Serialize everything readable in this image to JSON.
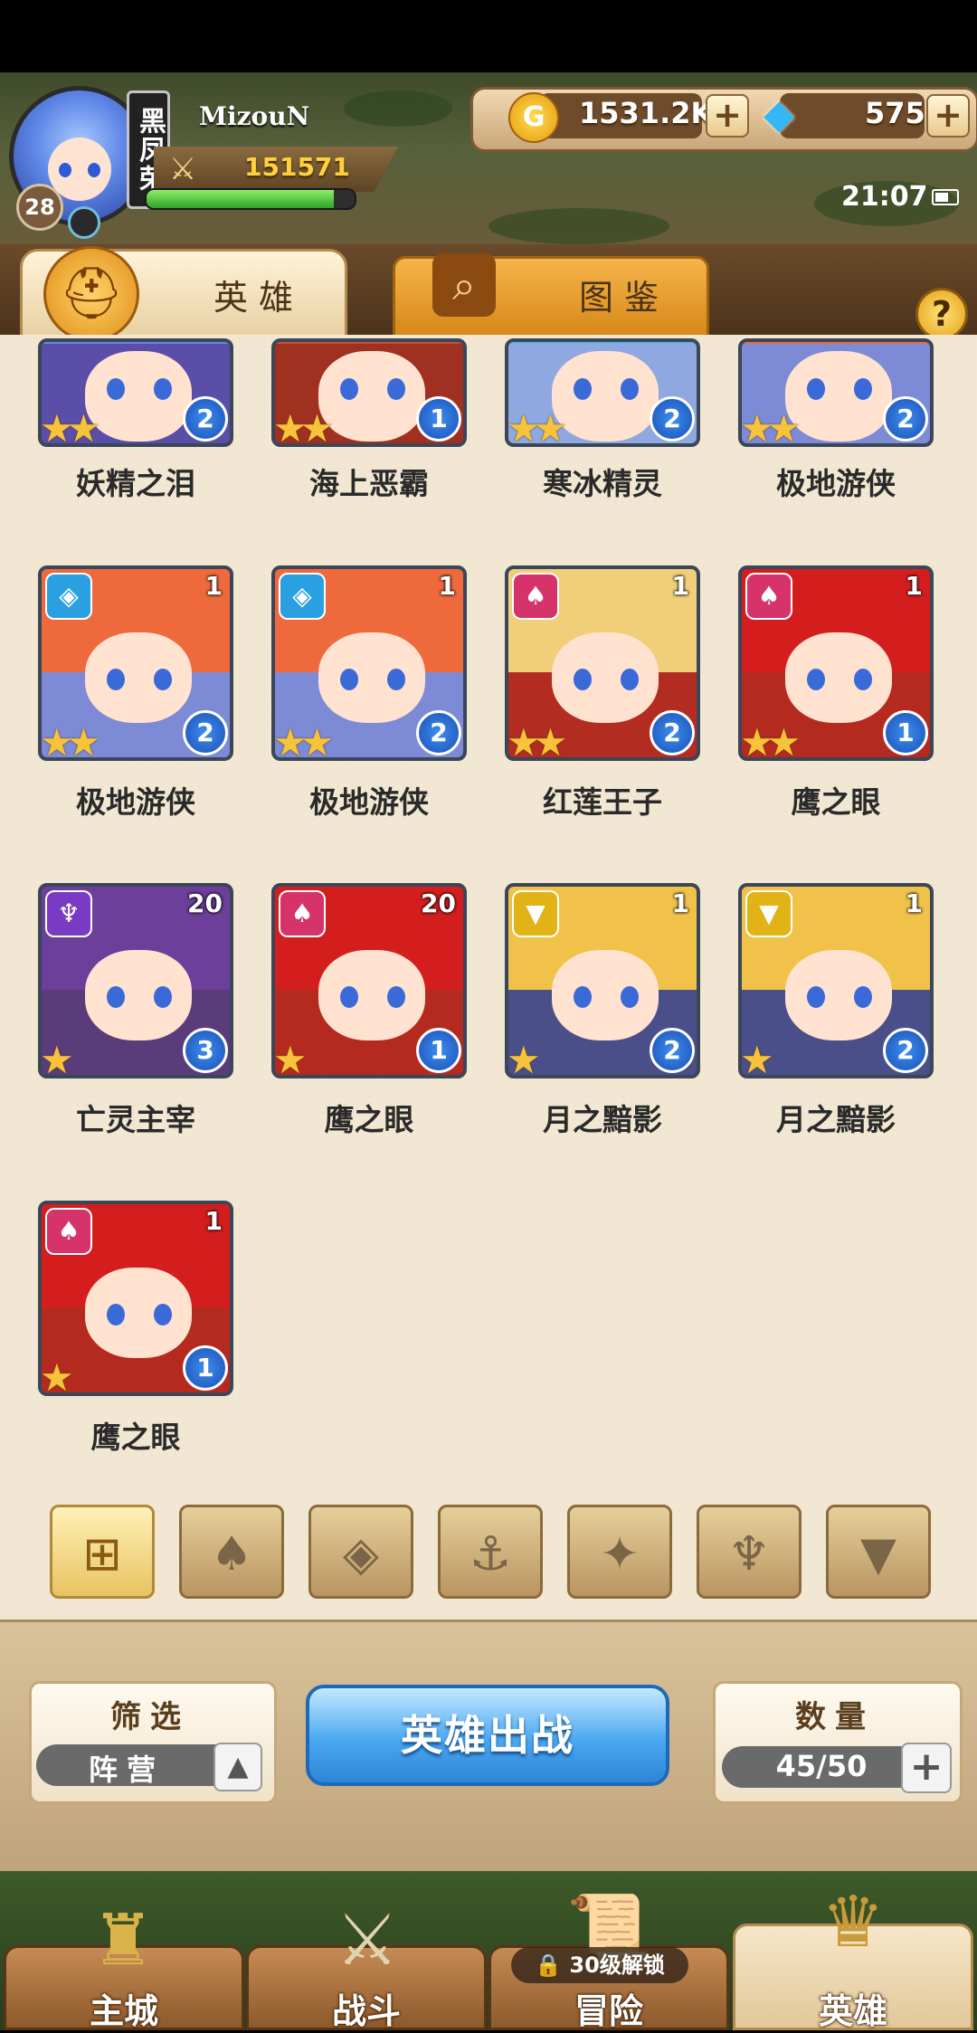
{
  "player": {
    "name": "MizouN",
    "level": "28",
    "power": "151571",
    "exp_fraction": 0.9,
    "vip_label": "黑凤荣"
  },
  "currency": {
    "gold": "1531.2K",
    "gems": "575",
    "gold_icon_letter": "G",
    "plus": "+"
  },
  "status": {
    "time": "21:07"
  },
  "tabs": [
    {
      "label": "英雄",
      "icon": "helmet-icon"
    },
    {
      "label": "图鉴",
      "icon": "magnifier-icon"
    }
  ],
  "help": "?",
  "heroes": [
    {
      "name": "妖精之泪",
      "count": "",
      "grade": "2",
      "stars": "★★",
      "faction": ""
    },
    {
      "name": "海上恶霸",
      "count": "",
      "grade": "1",
      "stars": "★★",
      "faction": ""
    },
    {
      "name": "寒冰精灵",
      "count": "",
      "grade": "2",
      "stars": "★★",
      "faction": ""
    },
    {
      "name": "极地游侠",
      "count": "",
      "grade": "2",
      "stars": "★★",
      "faction": ""
    },
    {
      "name": "极地游侠",
      "count": "1",
      "grade": "2",
      "stars": "★★",
      "faction": "◈"
    },
    {
      "name": "极地游侠",
      "count": "1",
      "grade": "2",
      "stars": "★★",
      "faction": "◈"
    },
    {
      "name": "红莲王子",
      "count": "1",
      "grade": "2",
      "stars": "★★",
      "faction": "♠"
    },
    {
      "name": "鹰之眼",
      "count": "1",
      "grade": "1",
      "stars": "★★",
      "faction": "♠"
    },
    {
      "name": "亡灵主宰",
      "count": "20",
      "grade": "3",
      "stars": "★",
      "faction": "♆"
    },
    {
      "name": "鹰之眼",
      "count": "20",
      "grade": "1",
      "stars": "★",
      "faction": "♠"
    },
    {
      "name": "月之黯影",
      "count": "1",
      "grade": "2",
      "stars": "★",
      "faction": "▼"
    },
    {
      "name": "月之黯影",
      "count": "1",
      "grade": "2",
      "stars": "★",
      "faction": "▼"
    },
    {
      "name": "鹰之眼",
      "count": "1",
      "grade": "1",
      "stars": "★",
      "faction": "♠"
    }
  ],
  "filters": [
    {
      "icon": "all-grid-icon",
      "glyph": "⊞"
    },
    {
      "icon": "fire-faction-icon",
      "glyph": "♠"
    },
    {
      "icon": "ice-faction-icon",
      "glyph": "◈"
    },
    {
      "icon": "anchor-faction-icon",
      "glyph": "⚓"
    },
    {
      "icon": "beast-faction-icon",
      "glyph": "✦"
    },
    {
      "icon": "undead-faction-icon",
      "glyph": "♆"
    },
    {
      "icon": "moon-faction-icon",
      "glyph": "▼"
    }
  ],
  "controls": {
    "filter_title": "筛选",
    "filter_value": "阵营",
    "filter_arrow": "▲",
    "deploy_label": "英雄出战",
    "count_title": "数量",
    "count_value": "45/50",
    "count_plus": "+"
  },
  "nav": [
    {
      "label": "主城",
      "icon": "castle-icon"
    },
    {
      "label": "战斗",
      "icon": "crossed-swords-icon"
    },
    {
      "label": "冒险",
      "icon": "scroll-map-icon",
      "lock": "30级解锁"
    },
    {
      "label": "英雄",
      "icon": "hero-crest-icon"
    }
  ],
  "colors": {
    "accent_blue": "#3d8ef0",
    "gold": "#ffd23b",
    "panel": "#f1e7d2",
    "star": "#f6c33a"
  }
}
